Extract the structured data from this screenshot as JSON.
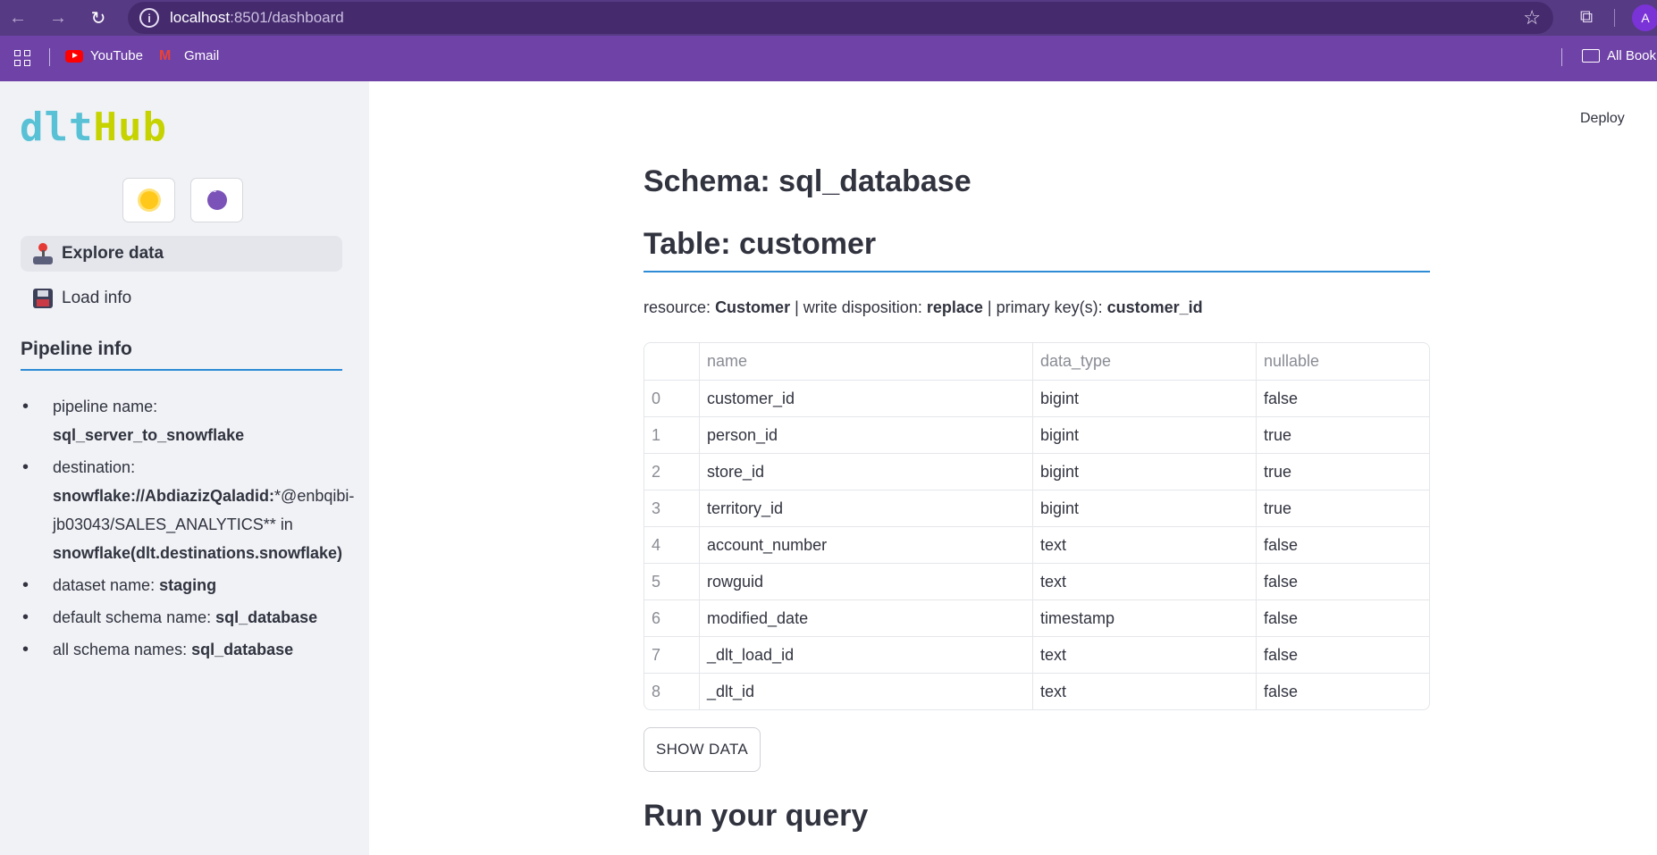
{
  "browser": {
    "url_host": "localhost",
    "url_path": ":8501/dashboard",
    "profile_initial": "A",
    "bookmarks": [
      {
        "label": "YouTube",
        "icon": "youtube-icon"
      },
      {
        "label": "Gmail",
        "icon": "gmail-icon"
      }
    ],
    "all_bookmarks_label": "All Book"
  },
  "sidebar": {
    "logo": {
      "part1": "dlt",
      "part2": "Hub"
    },
    "theme_buttons": [
      {
        "icon": "sun-icon"
      },
      {
        "icon": "moon-icon"
      }
    ],
    "nav": [
      {
        "label": "Explore data",
        "icon": "joystick-icon",
        "selected": true
      },
      {
        "label": "Load info",
        "icon": "floppy-disk-icon",
        "selected": false
      }
    ],
    "pipeline_heading": "Pipeline info",
    "info": {
      "pipeline_name_label": "pipeline name:",
      "pipeline_name": "sql_server_to_snowflake",
      "destination_label": "destination:",
      "destination_bold": "snowflake://AbdiazizQaladid:",
      "destination_rest": "*@enbqibi-jb03043/SALES_ANALYTICS** in",
      "destination_type": "snowflake(dlt.destinations.snowflake)",
      "dataset_label": "dataset name:",
      "dataset": "staging",
      "default_schema_label": "default schema name:",
      "default_schema": "sql_database",
      "all_schemas_label": "all schema names:",
      "all_schemas": "sql_database"
    }
  },
  "header": {
    "deploy_label": "Deploy"
  },
  "main": {
    "schema_title": "Schema: sql_database",
    "table_title": "Table: customer",
    "meta": {
      "resource_label": "resource:",
      "resource": "Customer",
      "write_label": "| write disposition:",
      "write": "replace",
      "pk_label": "| primary key(s):",
      "pk": "customer_id"
    },
    "columns": [
      "",
      "name",
      "data_type",
      "nullable"
    ],
    "rows": [
      {
        "idx": "0",
        "name": "customer_id",
        "data_type": "bigint",
        "nullable": "false"
      },
      {
        "idx": "1",
        "name": "person_id",
        "data_type": "bigint",
        "nullable": "true"
      },
      {
        "idx": "2",
        "name": "store_id",
        "data_type": "bigint",
        "nullable": "true"
      },
      {
        "idx": "3",
        "name": "territory_id",
        "data_type": "bigint",
        "nullable": "true"
      },
      {
        "idx": "4",
        "name": "account_number",
        "data_type": "text",
        "nullable": "false"
      },
      {
        "idx": "5",
        "name": "rowguid",
        "data_type": "text",
        "nullable": "false"
      },
      {
        "idx": "6",
        "name": "modified_date",
        "data_type": "timestamp",
        "nullable": "false"
      },
      {
        "idx": "7",
        "name": "_dlt_load_id",
        "data_type": "text",
        "nullable": "false"
      },
      {
        "idx": "8",
        "name": "_dlt_id",
        "data_type": "text",
        "nullable": "false"
      }
    ],
    "show_data_label": "SHOW DATA",
    "query_title": "Run your query"
  },
  "colors": {
    "browser_top": "#573a84",
    "bookmarks_bar": "#6f42a7",
    "sidebar_bg": "#f0f2f6",
    "accent_underline": "#2e8bd6",
    "logo_dlt": "#59c1d5",
    "logo_hub": "#c6d300"
  }
}
